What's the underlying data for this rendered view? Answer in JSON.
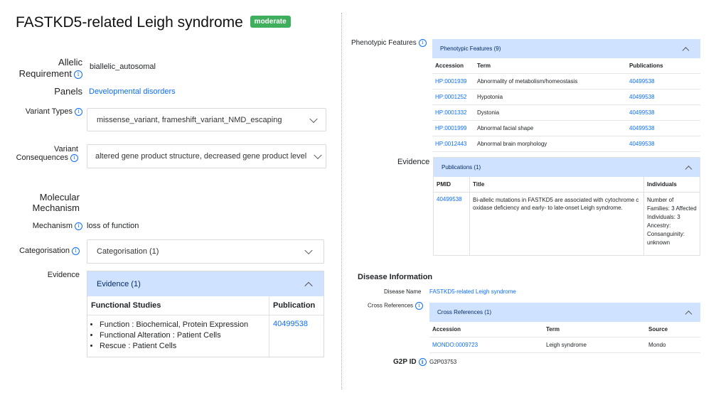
{
  "page": {
    "title": "FASTKD5-related Leigh syndrome",
    "confidence_badge": "moderate",
    "info_glyph": "i"
  },
  "left": {
    "allelic_label_line1": "Allelic",
    "allelic_label_line2": "Requirement",
    "allelic_value": "biallelic_autosomal",
    "panels_label": "Panels",
    "panels_value": "Developmental disorders",
    "variant_types_label": "Variant Types",
    "variant_types_value": "missense_variant, frameshift_variant_NMD_escaping",
    "variant_consequences_label_line1": "Variant",
    "variant_consequences_label_line2": "Consequences",
    "variant_consequences_value": "altered gene product structure, decreased gene product level",
    "molecular_mechanism_line1": "Molecular",
    "molecular_mechanism_line2": "Mechanism",
    "mechanism_label": "Mechanism",
    "mechanism_value": "loss of function",
    "categorisation_label": "Categorisation",
    "categorisation_value": "Categorisation (1)",
    "evidence_label": "Evidence",
    "evidence_accordion": "Evidence (1)",
    "evidence_table": {
      "headers": [
        "Functional Studies",
        "Publication"
      ],
      "items": [
        "Function : Biochemical, Protein Expression",
        "Functional Alteration : Patient Cells",
        "Rescue : Patient Cells"
      ],
      "publication": "40499538"
    }
  },
  "right": {
    "phenotypic_label": "Phenotypic Features",
    "phenotypic_accordion": "Phenotypic Features (9)",
    "phenotype_headers": [
      "Accession",
      "Term",
      "Publications"
    ],
    "phenotype_rows": [
      {
        "accession": "HP:0001939",
        "term": "Abnormality of metabolism/homeostasis",
        "pub": "40499538"
      },
      {
        "accession": "HP:0001252",
        "term": "Hypotonia",
        "pub": "40499538"
      },
      {
        "accession": "HP:0001332",
        "term": "Dystonia",
        "pub": "40499538"
      },
      {
        "accession": "HP:0001999",
        "term": "Abnormal facial shape",
        "pub": "40499538"
      },
      {
        "accession": "HP:0012443",
        "term": "Abnormal brain morphology",
        "pub": "40499538"
      }
    ],
    "evidence_label": "Evidence",
    "publications_accordion": "Publications (1)",
    "pub_headers": [
      "PMID",
      "Title",
      "Individuals"
    ],
    "pub_row": {
      "pmid": "40499538",
      "title": "Bi-allelic mutations in FASTKD5 are associated with cytochrome c oxidase deficiency and early- to late-onset Leigh syndrome.",
      "individuals": "Number of Families: 3 Affected Individuals: 3 Ancestry: Consanguinity: unknown"
    },
    "disease_info_heading": "Disease Information",
    "disease_name_label": "Disease Name",
    "disease_name_value": "FASTKD5-related Leigh syndrome",
    "cross_refs_label": "Cross References",
    "cross_refs_accordion": "Cross References (1)",
    "cross_headers": [
      "Accession",
      "Term",
      "Source"
    ],
    "cross_row": {
      "accession": "MONDO:0009723",
      "term": "Leigh syndrome",
      "source": "Mondo"
    },
    "g2p_label": "G2P ID",
    "g2p_value": "G2P03753"
  }
}
